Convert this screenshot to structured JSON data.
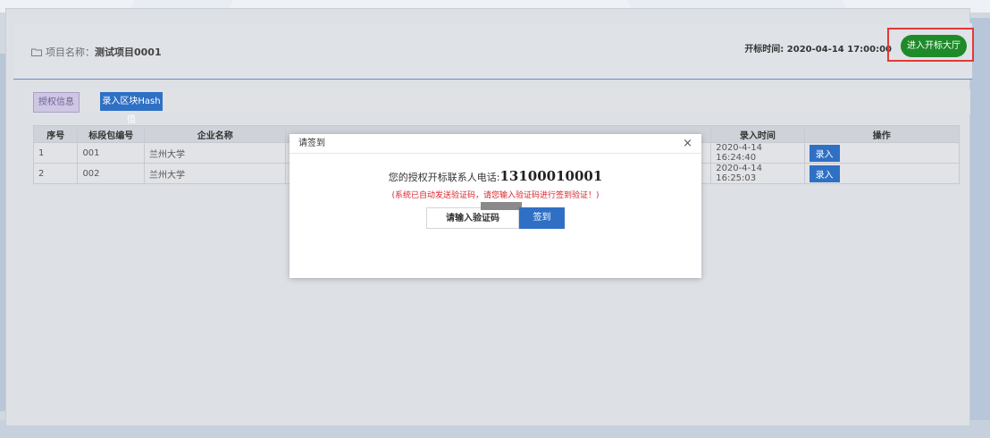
{
  "header": {
    "project_label": "项目名称：",
    "project_name": "测试项目0001",
    "open_time_label": "开标时间: ",
    "open_time_value": "2020-04-14 17:00:00",
    "enter_button": "进入开标大厅"
  },
  "tabs": [
    {
      "label": "授权信息"
    },
    {
      "label": "录入区块Hash值"
    }
  ],
  "table": {
    "columns": [
      "序号",
      "标段包编号",
      "企业名称",
      "",
      "录入时间",
      "操作"
    ],
    "rows": [
      {
        "index": "1",
        "code": "001",
        "company": "兰州大学",
        "time": "2020-4-14 16:24:40",
        "action": "录入"
      },
      {
        "index": "2",
        "code": "002",
        "company": "兰州大学",
        "time": "2020-4-14 16:25:03",
        "action": "录入"
      }
    ]
  },
  "modal": {
    "title": "请签到",
    "close": "×",
    "phone_label": "您的授权开标联系人电话:",
    "phone_number": "13100010001",
    "notice": "(系统已自动发送验证码，请您输入验证码进行签到验证！)",
    "code_placeholder": "请输入验证码",
    "signin_button": "签到"
  },
  "colors": {
    "accent": "#2f70c5",
    "enter_button": "#1f8a2a",
    "highlight_border": "#e53935",
    "notice_text": "#d9262b"
  }
}
